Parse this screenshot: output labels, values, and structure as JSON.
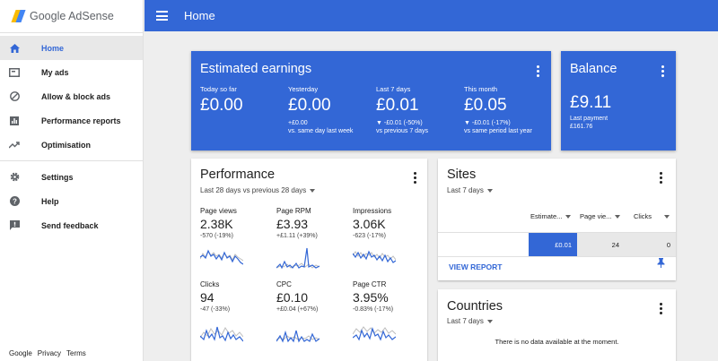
{
  "app": {
    "name": "Google AdSense"
  },
  "sidebar": {
    "items": [
      {
        "label": "Home",
        "icon": "home-icon"
      },
      {
        "label": "My ads",
        "icon": "ads-icon"
      },
      {
        "label": "Allow & block ads",
        "icon": "block-icon"
      },
      {
        "label": "Performance reports",
        "icon": "reports-icon"
      },
      {
        "label": "Optimisation",
        "icon": "trending-up-icon"
      },
      {
        "label": "Settings",
        "icon": "gear-icon"
      },
      {
        "label": "Help",
        "icon": "help-icon"
      },
      {
        "label": "Send feedback",
        "icon": "feedback-icon"
      }
    ],
    "footer": [
      "Google",
      "Privacy",
      "Terms"
    ]
  },
  "header": {
    "title": "Home"
  },
  "earnings": {
    "title": "Estimated earnings",
    "columns": [
      {
        "label": "Today so far",
        "value": "£0.00",
        "line1": "",
        "line2": ""
      },
      {
        "label": "Yesterday",
        "value": "£0.00",
        "line1": "+£0.00",
        "line2": "vs. same day last week"
      },
      {
        "label": "Last 7 days",
        "value": "£0.01",
        "line1": "▼ -£0.01 (-50%)",
        "line2": "vs previous 7 days"
      },
      {
        "label": "This month",
        "value": "£0.05",
        "line1": "▼ -£0.01 (-17%)",
        "line2": "vs same period last year"
      }
    ]
  },
  "balance": {
    "title": "Balance",
    "value": "£9.11",
    "last_payment_label": "Last payment",
    "last_payment_value": "£161.76"
  },
  "performance": {
    "title": "Performance",
    "period": "Last 28 days vs previous 28 days",
    "metrics": [
      {
        "label": "Page views",
        "value": "2.38K",
        "change": "-570 (-19%)"
      },
      {
        "label": "Page RPM",
        "value": "£3.93",
        "change": "+£1.11 (+39%)"
      },
      {
        "label": "Impressions",
        "value": "3.06K",
        "change": "-623 (-17%)"
      },
      {
        "label": "Clicks",
        "value": "94",
        "change": "-47 (-33%)"
      },
      {
        "label": "CPC",
        "value": "£0.10",
        "change": "+£0.04 (+67%)"
      },
      {
        "label": "Page CTR",
        "value": "3.95%",
        "change": "-0.83% (-17%)"
      }
    ]
  },
  "sites": {
    "title": "Sites",
    "period": "Last 7 days",
    "columns": [
      "Estimate...",
      "Page vie...",
      "Clicks"
    ],
    "row": {
      "site": "",
      "earnings": "£0.01",
      "page_views": "24",
      "clicks": "0"
    },
    "view_report": "VIEW REPORT"
  },
  "countries": {
    "title": "Countries",
    "period": "Last 7 days",
    "empty": "There is no data available at the moment."
  },
  "colors": {
    "primary": "#3367d6",
    "chart_line": "#3367d6",
    "chart_prev": "#bdbdbd",
    "sidebar_active": "#e8e8e8"
  }
}
